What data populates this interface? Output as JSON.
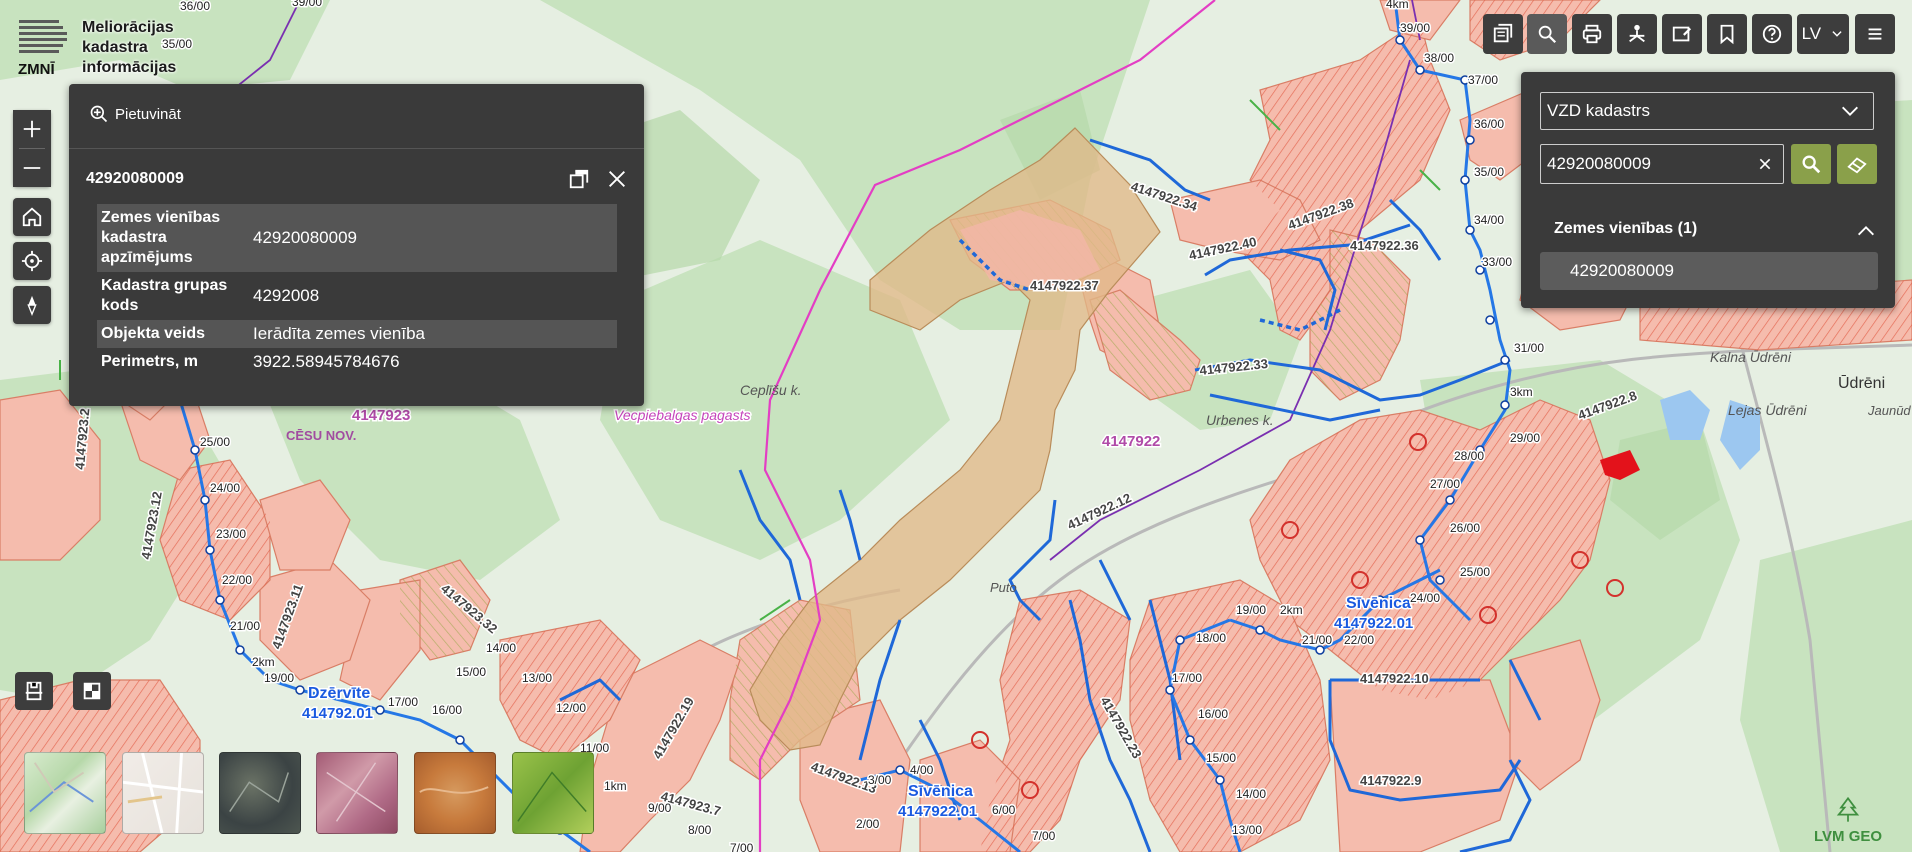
{
  "app": {
    "logo_short": "ZMNĪ",
    "title_lines": [
      "Meliorācijas",
      "kadastra",
      "informācijas"
    ]
  },
  "colors": {
    "panel_bg": "#3a3a3a",
    "control_bg": "#3d3d3d",
    "accent_green": "#8aa04a",
    "map_bg": "#e4eee0",
    "forest": "#c6e2bd",
    "parcel_highlight": "#e2b98a",
    "drained_land": "#f3b7a7",
    "ditch_line": "#1e66d6",
    "boundary_magenta": "#e53cc2"
  },
  "map_controls": {
    "zoom_in": "plus-icon",
    "zoom_out": "minus-icon",
    "home": "home-icon",
    "locate": "locate-icon",
    "compass": "compass-icon"
  },
  "popup": {
    "zoom_label": "Pietuvināt",
    "title": "42920080009",
    "attributes": [
      {
        "key": "Zemes vienības kadastra apzīmējums",
        "value": "42920080009"
      },
      {
        "key": "Kadastra grupas kods",
        "value": "4292008"
      },
      {
        "key": "Objekta veids",
        "value": "Ierādīta zemes vienība"
      },
      {
        "key": "Perimetrs, m",
        "value": "3922.58945784676"
      }
    ]
  },
  "toolbar": {
    "items": [
      "layers-icon",
      "search-icon",
      "print-icon",
      "share-icon",
      "edit-map-icon",
      "bookmark-icon",
      "help-icon"
    ],
    "language": "LV",
    "menu": "menu-icon"
  },
  "search_panel": {
    "source": "VZD kadastrs",
    "query": "42920080009",
    "results_heading": "Zemes vienības (1)",
    "results": [
      "42920080009"
    ]
  },
  "map_labels": {
    "ditch_codes": [
      "4147922.34",
      "4147922.38",
      "4147922.36",
      "4147922.40",
      "4147922.37",
      "4147922.33",
      "4147922.12",
      "4147922.8",
      "4147922.10",
      "4147922.9",
      "4147922.23",
      "4147923.11",
      "4147923.12",
      "4147923.2",
      "4147923.32",
      "4147922.19",
      "4147922.13",
      "4147923.7"
    ],
    "catchments": [
      "4147923",
      "4147922"
    ],
    "places": [
      "Ceplīšu k.",
      "Urbenes k.",
      "Ūdrēni",
      "Lejas Ūdrēni",
      "Kalna Ūdrēni",
      "Puto",
      "Jaunūd"
    ],
    "municipality": "CĒSU NOV.",
    "parish": "Vecpiebalgas pagasts",
    "rivers": [
      {
        "name": "Dzērvīte",
        "code": "414792.01"
      },
      {
        "name": "Sīvēnica",
        "code": "4147922.01"
      },
      {
        "name": "Sīvēnica",
        "code": "4147922.01"
      }
    ],
    "chainage_left": [
      "25/00",
      "24/00",
      "23/00",
      "22/00",
      "21/00",
      "2km",
      "19/00",
      "17/00",
      "16/00",
      "15/00",
      "14/00",
      "13/00",
      "12/00",
      "11/00",
      "1km",
      "9/00",
      "8/00",
      "7/00"
    ],
    "chainage_right": [
      "4km",
      "39/00",
      "38/00",
      "37/00",
      "36/00",
      "35/00",
      "34/00",
      "33/00",
      "31/00",
      "3km",
      "29/00",
      "28/00",
      "27/00",
      "26/00",
      "25/00",
      "24/00"
    ],
    "chainage_bottom": [
      "19/00",
      "2km",
      "21/00",
      "22/00",
      "18/00",
      "17/00",
      "16/00",
      "15/00",
      "14/00",
      "13/00",
      "4/00",
      "3/00",
      "2/00",
      "6/00",
      "7/00"
    ],
    "top_left": [
      "36/00",
      "39/00",
      "35/00"
    ]
  },
  "basemaps": [
    "topo-basemap",
    "street-basemap",
    "orthophoto-basemap",
    "infrared-basemap",
    "relief-basemap",
    "vegetation-basemap"
  ],
  "footer": {
    "brand": "LVM GEO"
  }
}
